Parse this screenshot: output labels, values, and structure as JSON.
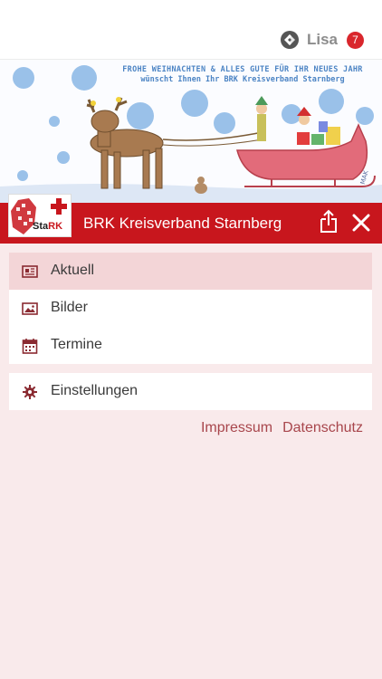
{
  "top_bar": {
    "user_name": "Lisa",
    "notification_count": "7",
    "user_icon": "user-switch-icon"
  },
  "banner": {
    "line1": "FROHE WEIHNACHTEN & ALLES GUTE FÜR IHR NEUES JAHR",
    "line2": "wünscht Ihnen Ihr BRK Kreisverband Starnberg",
    "signature": "MAK"
  },
  "header": {
    "logo_text_prefix": "Sta",
    "logo_text_suffix": "RK",
    "title": "BRK Kreisverband Starnberg",
    "share_icon": "share-icon",
    "close_icon": "close-icon",
    "accent_color": "#c8161d"
  },
  "menu": {
    "items": [
      {
        "label": "Aktuell",
        "icon": "news-icon",
        "active": true
      },
      {
        "label": "Bilder",
        "icon": "image-icon",
        "active": false
      },
      {
        "label": "Termine",
        "icon": "calendar-icon",
        "active": false
      }
    ],
    "settings": {
      "label": "Einstellungen",
      "icon": "gear-icon"
    }
  },
  "footer": {
    "impressum": "Impressum",
    "datenschutz": "Datenschutz"
  }
}
